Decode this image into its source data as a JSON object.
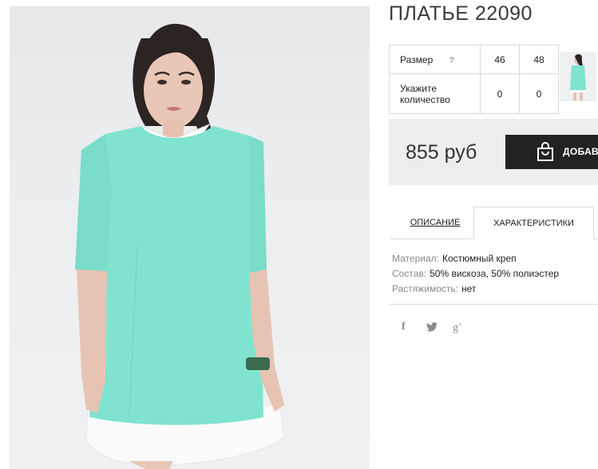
{
  "product": {
    "title": "ПЛАТЬЕ 22090"
  },
  "sizes": {
    "size_label": "Размер",
    "help_mark": "?",
    "quantity_label": "Укажите количество",
    "options": [
      {
        "size": "46",
        "quantity": "0"
      },
      {
        "size": "48",
        "quantity": "0"
      }
    ]
  },
  "purchase": {
    "price": "855 руб",
    "add_button_label": "ДОБАВИ"
  },
  "tabs": [
    {
      "label": "ОПИСАНИЕ",
      "active": false
    },
    {
      "label": "ХАРАКТЕРИСТИКИ",
      "active": true
    }
  ],
  "characteristics": [
    {
      "key": "Материал:",
      "value": "Костюмный креп"
    },
    {
      "key": "Состав:",
      "value": "50% вискоза, 50% полиэстер"
    },
    {
      "key": "Растяжимость:",
      "value": "нет"
    }
  ],
  "social": [
    {
      "icon": "facebook-icon",
      "glyph": "f"
    },
    {
      "icon": "twitter-icon",
      "glyph": "🐦"
    },
    {
      "icon": "google-plus-icon",
      "glyph": "g+"
    }
  ],
  "colors": {
    "dress": "#7fe3d0",
    "button": "#222222",
    "price_bg": "#eeeeee"
  }
}
